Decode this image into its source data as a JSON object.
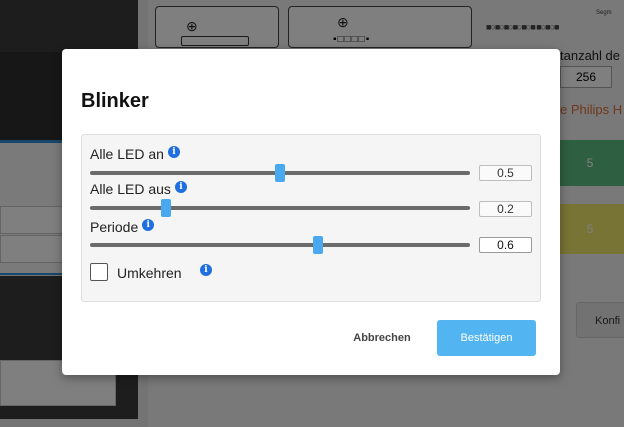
{
  "background": {
    "column_label": "tanzahl de",
    "count_value": "256",
    "brand_text": "e Philips H",
    "green_value": "5",
    "yellow_value": "5",
    "konfig_button": "Konfi",
    "segment_label": "Segm",
    "led_row": "■○■○■○■○■○■ ■○■○■",
    "strip_glyphs": "▪□□□□▪",
    "colors": {
      "green": "#5fbf83",
      "yellow": "#efe86a",
      "orange": "#e0703a"
    }
  },
  "dialog": {
    "title": "Blinker",
    "sliders": [
      {
        "label": "Alle LED an",
        "value": "0.5",
        "fraction": 0.5
      },
      {
        "label": "Alle LED aus",
        "value": "0.2",
        "fraction": 0.2
      },
      {
        "label": "Periode",
        "value": "0.6",
        "fraction": 0.6
      }
    ],
    "checkbox": {
      "label": "Umkehren",
      "checked": false
    },
    "info_glyph": "i",
    "buttons": {
      "cancel": "Abbrechen",
      "confirm": "Bestätigen"
    },
    "accent_color": "#52b4f0",
    "info_color": "#1f6fe0"
  }
}
